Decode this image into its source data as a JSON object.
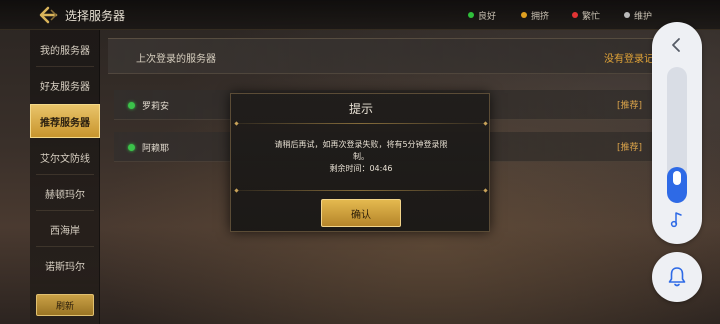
{
  "header": {
    "title": "选择服务器",
    "legend": [
      {
        "label": "良好",
        "color": "#2fbf3b"
      },
      {
        "label": "拥挤",
        "color": "#e0a020"
      },
      {
        "label": "繁忙",
        "color": "#e23434"
      },
      {
        "label": "维护",
        "color": "#bbbbbb"
      }
    ]
  },
  "sidebar": {
    "items": [
      {
        "label": "我的服务器"
      },
      {
        "label": "好友服务器"
      },
      {
        "label": "推荐服务器",
        "active": true
      },
      {
        "label": "艾尔文防线"
      },
      {
        "label": "赫顿玛尔"
      },
      {
        "label": "西海岸"
      },
      {
        "label": "诺斯玛尔"
      }
    ],
    "refresh_label": "刷新"
  },
  "main": {
    "section_title": "上次登录的服务器",
    "no_login_text": "没有登录记录",
    "servers": [
      {
        "name": "罗莉安",
        "tag": "[推荐]",
        "status_color": "#3bc24a"
      },
      {
        "name": "阿赖耶",
        "tag": "[推荐]",
        "status_color": "#3bc24a"
      }
    ]
  },
  "dialog": {
    "title": "提示",
    "message_line1": "请稍后再试，如再次登录失败，将有5分钟登录限",
    "message_line2": "制。",
    "message_line3": "剩余时间：04:46",
    "confirm_label": "确认"
  },
  "float_panel": {
    "volume_level": 0.16,
    "icons": [
      "chevron-left-icon",
      "music-note-icon",
      "bell-icon"
    ],
    "accent_color": "#2e6ae6"
  }
}
